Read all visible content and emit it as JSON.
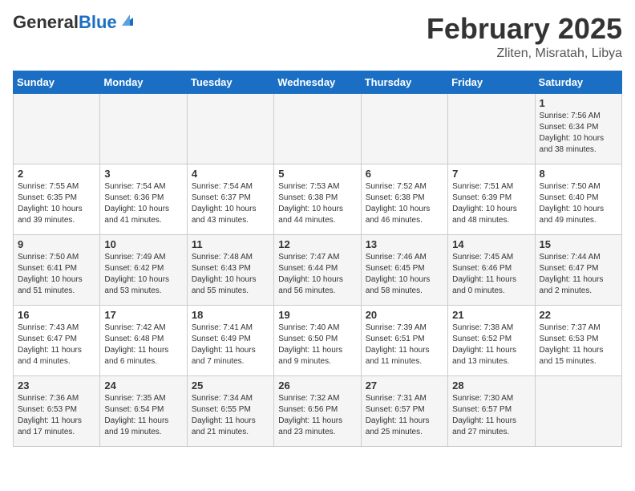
{
  "header": {
    "logo_general": "General",
    "logo_blue": "Blue",
    "month": "February 2025",
    "location": "Zliten, Misratah, Libya"
  },
  "weekdays": [
    "Sunday",
    "Monday",
    "Tuesday",
    "Wednesday",
    "Thursday",
    "Friday",
    "Saturday"
  ],
  "weeks": [
    [
      {
        "day": "",
        "info": ""
      },
      {
        "day": "",
        "info": ""
      },
      {
        "day": "",
        "info": ""
      },
      {
        "day": "",
        "info": ""
      },
      {
        "day": "",
        "info": ""
      },
      {
        "day": "",
        "info": ""
      },
      {
        "day": "1",
        "info": "Sunrise: 7:56 AM\nSunset: 6:34 PM\nDaylight: 10 hours and 38 minutes."
      }
    ],
    [
      {
        "day": "2",
        "info": "Sunrise: 7:55 AM\nSunset: 6:35 PM\nDaylight: 10 hours and 39 minutes."
      },
      {
        "day": "3",
        "info": "Sunrise: 7:54 AM\nSunset: 6:36 PM\nDaylight: 10 hours and 41 minutes."
      },
      {
        "day": "4",
        "info": "Sunrise: 7:54 AM\nSunset: 6:37 PM\nDaylight: 10 hours and 43 minutes."
      },
      {
        "day": "5",
        "info": "Sunrise: 7:53 AM\nSunset: 6:38 PM\nDaylight: 10 hours and 44 minutes."
      },
      {
        "day": "6",
        "info": "Sunrise: 7:52 AM\nSunset: 6:38 PM\nDaylight: 10 hours and 46 minutes."
      },
      {
        "day": "7",
        "info": "Sunrise: 7:51 AM\nSunset: 6:39 PM\nDaylight: 10 hours and 48 minutes."
      },
      {
        "day": "8",
        "info": "Sunrise: 7:50 AM\nSunset: 6:40 PM\nDaylight: 10 hours and 49 minutes."
      }
    ],
    [
      {
        "day": "9",
        "info": "Sunrise: 7:50 AM\nSunset: 6:41 PM\nDaylight: 10 hours and 51 minutes."
      },
      {
        "day": "10",
        "info": "Sunrise: 7:49 AM\nSunset: 6:42 PM\nDaylight: 10 hours and 53 minutes."
      },
      {
        "day": "11",
        "info": "Sunrise: 7:48 AM\nSunset: 6:43 PM\nDaylight: 10 hours and 55 minutes."
      },
      {
        "day": "12",
        "info": "Sunrise: 7:47 AM\nSunset: 6:44 PM\nDaylight: 10 hours and 56 minutes."
      },
      {
        "day": "13",
        "info": "Sunrise: 7:46 AM\nSunset: 6:45 PM\nDaylight: 10 hours and 58 minutes."
      },
      {
        "day": "14",
        "info": "Sunrise: 7:45 AM\nSunset: 6:46 PM\nDaylight: 11 hours and 0 minutes."
      },
      {
        "day": "15",
        "info": "Sunrise: 7:44 AM\nSunset: 6:47 PM\nDaylight: 11 hours and 2 minutes."
      }
    ],
    [
      {
        "day": "16",
        "info": "Sunrise: 7:43 AM\nSunset: 6:47 PM\nDaylight: 11 hours and 4 minutes."
      },
      {
        "day": "17",
        "info": "Sunrise: 7:42 AM\nSunset: 6:48 PM\nDaylight: 11 hours and 6 minutes."
      },
      {
        "day": "18",
        "info": "Sunrise: 7:41 AM\nSunset: 6:49 PM\nDaylight: 11 hours and 7 minutes."
      },
      {
        "day": "19",
        "info": "Sunrise: 7:40 AM\nSunset: 6:50 PM\nDaylight: 11 hours and 9 minutes."
      },
      {
        "day": "20",
        "info": "Sunrise: 7:39 AM\nSunset: 6:51 PM\nDaylight: 11 hours and 11 minutes."
      },
      {
        "day": "21",
        "info": "Sunrise: 7:38 AM\nSunset: 6:52 PM\nDaylight: 11 hours and 13 minutes."
      },
      {
        "day": "22",
        "info": "Sunrise: 7:37 AM\nSunset: 6:53 PM\nDaylight: 11 hours and 15 minutes."
      }
    ],
    [
      {
        "day": "23",
        "info": "Sunrise: 7:36 AM\nSunset: 6:53 PM\nDaylight: 11 hours and 17 minutes."
      },
      {
        "day": "24",
        "info": "Sunrise: 7:35 AM\nSunset: 6:54 PM\nDaylight: 11 hours and 19 minutes."
      },
      {
        "day": "25",
        "info": "Sunrise: 7:34 AM\nSunset: 6:55 PM\nDaylight: 11 hours and 21 minutes."
      },
      {
        "day": "26",
        "info": "Sunrise: 7:32 AM\nSunset: 6:56 PM\nDaylight: 11 hours and 23 minutes."
      },
      {
        "day": "27",
        "info": "Sunrise: 7:31 AM\nSunset: 6:57 PM\nDaylight: 11 hours and 25 minutes."
      },
      {
        "day": "28",
        "info": "Sunrise: 7:30 AM\nSunset: 6:57 PM\nDaylight: 11 hours and 27 minutes."
      },
      {
        "day": "",
        "info": ""
      }
    ]
  ]
}
